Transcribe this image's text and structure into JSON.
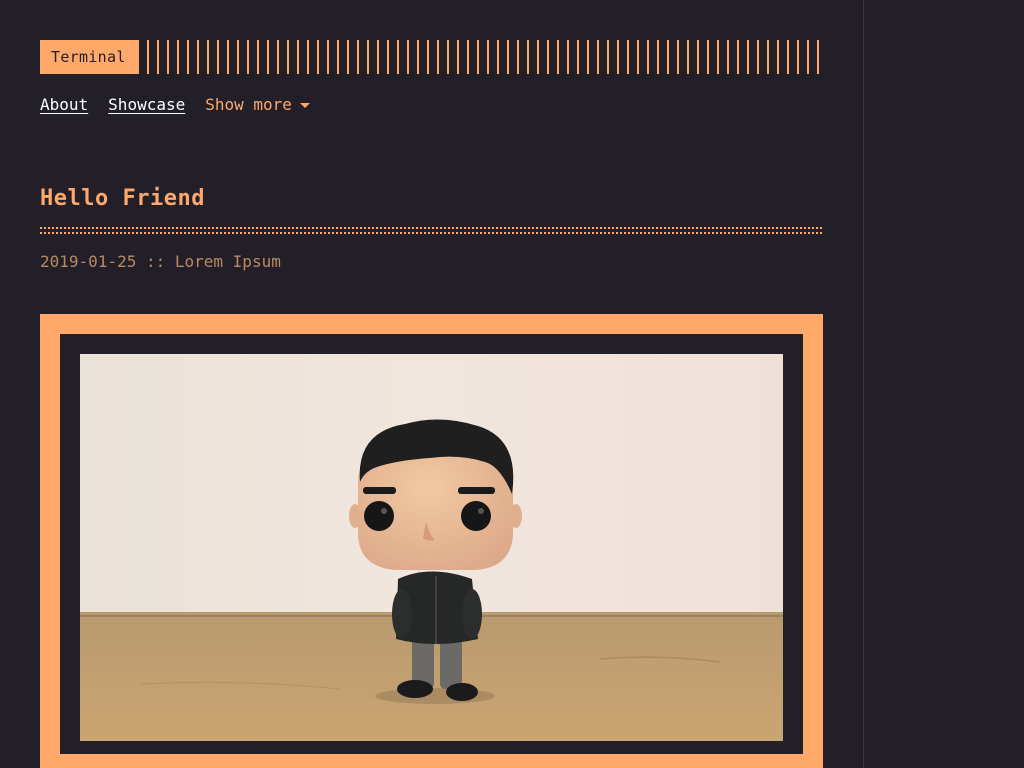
{
  "header": {
    "logo_text": "Terminal"
  },
  "nav": {
    "items": [
      {
        "label": "About"
      },
      {
        "label": "Showcase"
      }
    ],
    "more_label": "Show more"
  },
  "post": {
    "title": "Hello Friend",
    "date": "2019-01-25",
    "meta_separator": "::",
    "author": "Lorem Ipsum",
    "cover": {
      "description_icon": "vinyl-figure-photo"
    }
  },
  "colors": {
    "background": "#221f29",
    "accent": "#ffa86a",
    "meta_text": "#b98a62",
    "nav_text": "#ffffff"
  }
}
